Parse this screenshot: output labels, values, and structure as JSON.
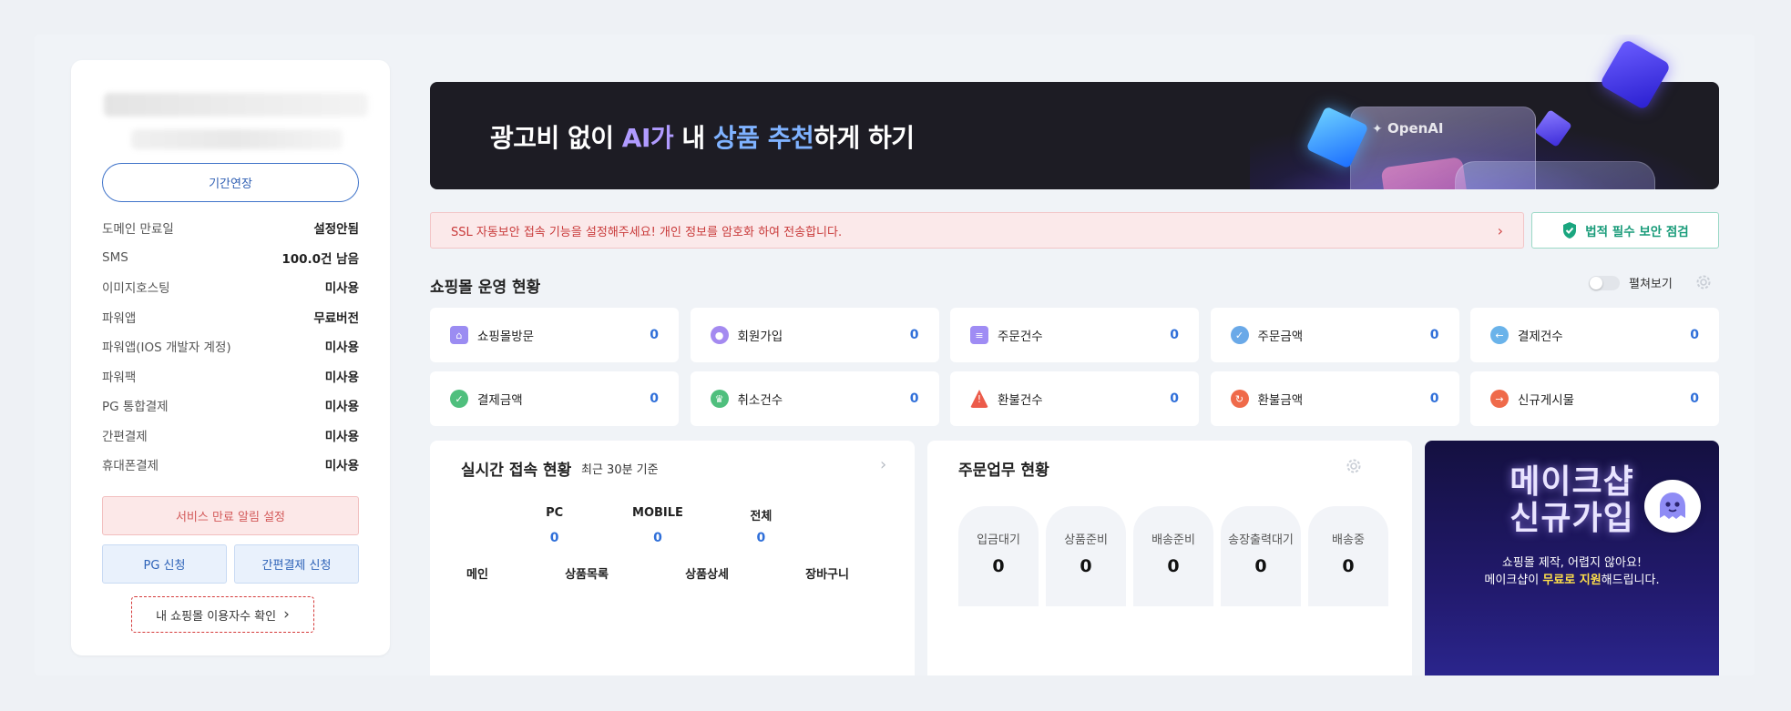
{
  "sidebar": {
    "extend_label": "기간연장",
    "info": [
      {
        "key": "도메인 만료일",
        "value": "설정안됨"
      },
      {
        "key": "SMS",
        "value": "100.0건 남음"
      },
      {
        "key": "이미지호스팅",
        "value": "미사용"
      },
      {
        "key": "파워앱",
        "value": "무료버전"
      },
      {
        "key": "파워앱(IOS 개발자 계정)",
        "value": "미사용"
      },
      {
        "key": "파워팩",
        "value": "미사용"
      },
      {
        "key": "PG 통합결제",
        "value": "미사용"
      },
      {
        "key": "간편결제",
        "value": "미사용"
      },
      {
        "key": "휴대폰결제",
        "value": "미사용"
      }
    ],
    "alert_label": "서비스 만료 알림 설정",
    "pg_label": "PG 신청",
    "easy_label": "간편결제 신청",
    "usage_label": "내 쇼핑몰 이용자수 확인",
    "usage_chevron": "›"
  },
  "banner": {
    "prefix": "광고비 없이 ",
    "ai": "AI가",
    "middle": " 내 ",
    "rec": "상품 추천",
    "suffix": "하게 하기",
    "openai": "OpenAI"
  },
  "ssl": {
    "message": "SSL 자동보안 접속 기능을 설정해주세요! 개인 정보를 암호화 하여 전송합니다.",
    "chevron": "›"
  },
  "security_label": "법적 필수 보안 점검",
  "ops": {
    "title": "쇼핑몰 운영 현황",
    "unfold_label": "펼쳐보기",
    "cards": [
      {
        "label": "쇼핑몰방문",
        "value": "0",
        "icon": "home-icon",
        "color": "#9b8cf2"
      },
      {
        "label": "회원가입",
        "value": "0",
        "icon": "user-icon",
        "color": "#a48af0"
      },
      {
        "label": "주문건수",
        "value": "0",
        "icon": "list-icon",
        "color": "#9f8cf4"
      },
      {
        "label": "주문금액",
        "value": "0",
        "icon": "check-circle-icon",
        "color": "#6aa9e8"
      },
      {
        "label": "결제건수",
        "value": "0",
        "icon": "arrow-left-circle-icon",
        "color": "#6ab3ea"
      },
      {
        "label": "결제금액",
        "value": "0",
        "icon": "check-circle-icon",
        "color": "#4fbf7d"
      },
      {
        "label": "취소건수",
        "value": "0",
        "icon": "crown-icon",
        "color": "#4fbf7d"
      },
      {
        "label": "환불건수",
        "value": "0",
        "icon": "warning-icon",
        "color": "#ec5b4a"
      },
      {
        "label": "환불금액",
        "value": "0",
        "icon": "refresh-icon",
        "color": "#ef6a4a"
      },
      {
        "label": "신규게시물",
        "value": "0",
        "icon": "arrow-right-circle-icon",
        "color": "#ef6a4a"
      }
    ]
  },
  "realtime": {
    "title": "실시간 접속 현황",
    "subtitle": "최근 30분 기준",
    "chevron": "›",
    "columns": [
      {
        "label": "PC",
        "value": "0"
      },
      {
        "label": "MOBILE",
        "value": "0"
      },
      {
        "label": "전체",
        "value": "0"
      }
    ],
    "row2": [
      "메인",
      "상품목록",
      "상품상세",
      "장바구니"
    ]
  },
  "orders": {
    "title": "주문업무 현황",
    "items": [
      {
        "label": "입금대기",
        "value": "0"
      },
      {
        "label": "상품준비",
        "value": "0"
      },
      {
        "label": "배송준비",
        "value": "0"
      },
      {
        "label": "송장출력대기",
        "value": "0"
      },
      {
        "label": "배송중",
        "value": "0"
      }
    ]
  },
  "promo": {
    "line1": "메이크샵",
    "line2": "신규가입",
    "sub1": "쇼핑몰 제작, 어렵지 않아요!",
    "sub2_a": "메이크샵이 ",
    "sub2_hl": "무료로 지원",
    "sub2_b": "해드립니다."
  }
}
